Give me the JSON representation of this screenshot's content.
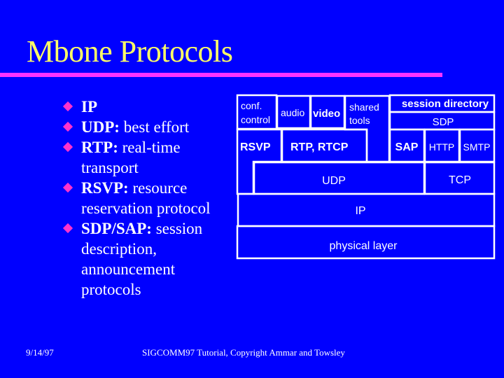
{
  "slide": {
    "title": "Mbone Protocols",
    "bullets": [
      {
        "bold": "IP",
        "text": ""
      },
      {
        "bold": "UDP:",
        "text": " best effort"
      },
      {
        "bold": "RTP:",
        "text": " real-time transport"
      },
      {
        "bold": "RSVP:",
        "text": " resource reservation protocol"
      },
      {
        "bold": "SDP/SAP:",
        "text": " session description, announcement protocols"
      }
    ],
    "footer_date": "9/14/97",
    "footer_copyright": "SIGCOMM97 Tutorial, Copyright Ammar and Towsley"
  },
  "colors": {
    "background": "#0000FF",
    "title": "#FFFF66",
    "rule": "#FF33FF",
    "bullet": "#FF33CC",
    "text": "#FFFFFF"
  },
  "diagram": {
    "conf_control": [
      "conf.",
      "control"
    ],
    "audio": "audio",
    "video": "video",
    "shared_tools": [
      "shared",
      "tools"
    ],
    "session_directory": "session directory",
    "sdp": "SDP",
    "rsvp": "RSVP",
    "rtp_rtcp": "RTP, RTCP",
    "sap": "SAP",
    "http": "HTTP",
    "smtp": "SMTP",
    "udp": "UDP",
    "tcp": "TCP",
    "ip": "IP",
    "physical": "physical layer"
  }
}
